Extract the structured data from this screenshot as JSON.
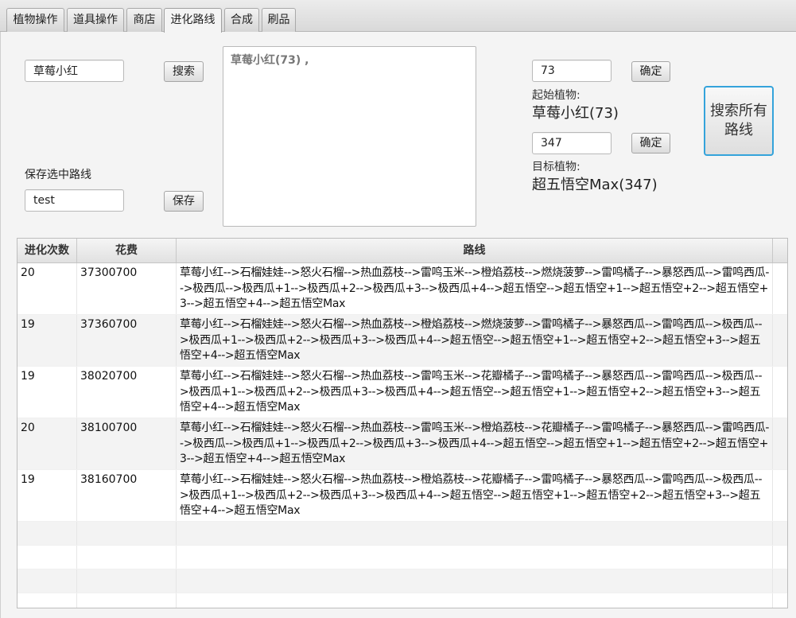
{
  "tabs": [
    {
      "label": "植物操作"
    },
    {
      "label": "道具操作"
    },
    {
      "label": "商店"
    },
    {
      "label": "进化路线"
    },
    {
      "label": "合成"
    },
    {
      "label": "刷品"
    }
  ],
  "search": {
    "value": "草莓小红",
    "button": "搜索"
  },
  "save": {
    "label": "保存选中路线",
    "value": "test",
    "button": "保存"
  },
  "result_text": "草莓小红(73) ,",
  "start": {
    "id_value": "73",
    "confirm": "确定",
    "label": "起始植物:",
    "name": "草莓小红(73)"
  },
  "target": {
    "id_value": "347",
    "confirm": "确定",
    "label": "目标植物:",
    "name": "超五悟空Max(347)"
  },
  "search_all_button": "搜索所有路线",
  "table": {
    "headers": [
      "进化次数",
      "花费",
      "路线"
    ],
    "rows": [
      {
        "count": "20",
        "cost": "37300700",
        "route": "草莓小红-->石榴娃娃-->怒火石榴-->热血荔枝-->雷鸣玉米-->橙焰荔枝-->燃烧菠萝-->雷鸣橘子-->暴怒西瓜-->雷鸣西瓜-->极西瓜-->极西瓜+1-->极西瓜+2-->极西瓜+3-->极西瓜+4-->超五悟空-->超五悟空+1-->超五悟空+2-->超五悟空+3-->超五悟空+4-->超五悟空Max"
      },
      {
        "count": "19",
        "cost": "37360700",
        "route": "草莓小红-->石榴娃娃-->怒火石榴-->热血荔枝-->橙焰荔枝-->燃烧菠萝-->雷鸣橘子-->暴怒西瓜-->雷鸣西瓜-->极西瓜-->极西瓜+1-->极西瓜+2-->极西瓜+3-->极西瓜+4-->超五悟空-->超五悟空+1-->超五悟空+2-->超五悟空+3-->超五悟空+4-->超五悟空Max"
      },
      {
        "count": "19",
        "cost": "38020700",
        "route": "草莓小红-->石榴娃娃-->怒火石榴-->热血荔枝-->雷鸣玉米-->花瓣橘子-->雷鸣橘子-->暴怒西瓜-->雷鸣西瓜-->极西瓜-->极西瓜+1-->极西瓜+2-->极西瓜+3-->极西瓜+4-->超五悟空-->超五悟空+1-->超五悟空+2-->超五悟空+3-->超五悟空+4-->超五悟空Max"
      },
      {
        "count": "20",
        "cost": "38100700",
        "route": "草莓小红-->石榴娃娃-->怒火石榴-->热血荔枝-->雷鸣玉米-->橙焰荔枝-->花瓣橘子-->雷鸣橘子-->暴怒西瓜-->雷鸣西瓜-->极西瓜-->极西瓜+1-->极西瓜+2-->极西瓜+3-->极西瓜+4-->超五悟空-->超五悟空+1-->超五悟空+2-->超五悟空+3-->超五悟空+4-->超五悟空Max"
      },
      {
        "count": "19",
        "cost": "38160700",
        "route": "草莓小红-->石榴娃娃-->怒火石榴-->热血荔枝-->橙焰荔枝-->花瓣橘子-->雷鸣橘子-->暴怒西瓜-->雷鸣西瓜-->极西瓜-->极西瓜+1-->极西瓜+2-->极西瓜+3-->极西瓜+4-->超五悟空-->超五悟空+1-->超五悟空+2-->超五悟空+3-->超五悟空+4-->超五悟空Max"
      }
    ]
  }
}
